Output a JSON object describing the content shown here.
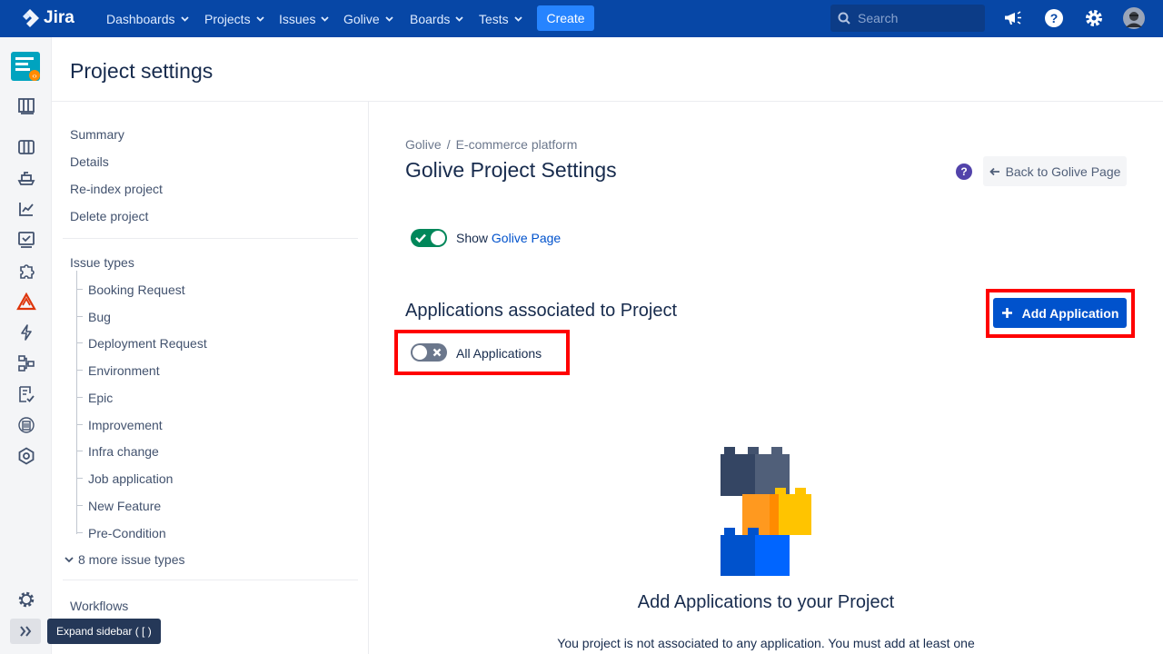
{
  "topnav": {
    "logo_text": "Jira",
    "items": [
      {
        "label": "Dashboards"
      },
      {
        "label": "Projects"
      },
      {
        "label": "Issues"
      },
      {
        "label": "Golive"
      },
      {
        "label": "Boards"
      },
      {
        "label": "Tests"
      }
    ],
    "create_label": "Create",
    "search_placeholder": "Search",
    "icons": [
      "megaphone-icon",
      "help-icon",
      "gear-icon",
      "avatar"
    ],
    "colors": {
      "bar": "#0747a6",
      "create": "#2684ff"
    }
  },
  "rail": {
    "icons": [
      "project-avatar",
      "board-icon",
      "columns-icon",
      "ship-icon",
      "chart-icon",
      "checklist-icon",
      "puzzle-icon",
      "warning-icon",
      "bolt-icon",
      "diagram-icon",
      "document-check-icon",
      "building-icon",
      "hexagon-icon",
      "settings-icon"
    ],
    "expand_tooltip": "Expand sidebar ( [ )"
  },
  "header": {
    "title": "Project settings"
  },
  "settings_nav": {
    "top_items": [
      "Summary",
      "Details",
      "Re-index project",
      "Delete project"
    ],
    "issue_types_label": "Issue types",
    "issue_types": [
      "Booking Request",
      "Bug",
      "Deployment Request",
      "Environment",
      "Epic",
      "Improvement",
      "Infra change",
      "Job application",
      "New Feature",
      "Pre-Condition"
    ],
    "more_label": "8 more issue types",
    "workflows_label": "Workflows"
  },
  "main": {
    "breadcrumb": {
      "first": "Golive",
      "separator": "/",
      "second": "E-commerce platform"
    },
    "title": "Golive Project Settings",
    "help_glyph": "?",
    "back_label": "Back to Golive Page",
    "show_toggle": {
      "prefix": "Show",
      "link": "Golive Page",
      "on": true
    },
    "section_title": "Applications associated to Project",
    "all_apps_toggle": {
      "label": "All Applications",
      "on": false
    },
    "add_button_label": "Add Application",
    "empty_title": "Add Applications to your Project",
    "empty_desc": "You project is not associated to any application. You must add at least one",
    "colors": {
      "primary": "#0052cc",
      "toggle_on": "#00875a",
      "highlight": "#ff0000"
    }
  }
}
